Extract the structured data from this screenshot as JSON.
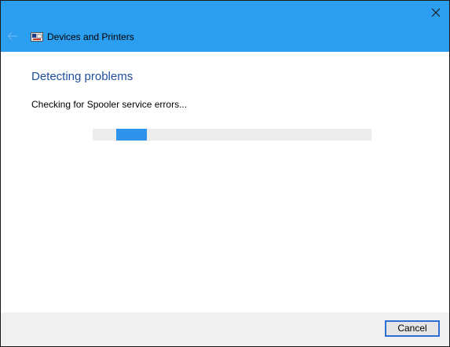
{
  "window": {
    "title": "Devices and Printers",
    "icons": {
      "back": "back-arrow-icon",
      "app": "devices-printers-icon",
      "close": "close-icon"
    },
    "colors": {
      "titlebar": "#2b9ef0",
      "heading": "#1f4e9c",
      "progress_fill": "#2e93ea",
      "progress_track": "#ececec",
      "footer": "#f0f0f0"
    }
  },
  "main": {
    "heading": "Detecting problems",
    "status": "Checking for Spooler service errors...",
    "progress": {
      "mode": "indeterminate",
      "segment_start": 0.085,
      "segment_end": 0.195
    }
  },
  "footer": {
    "cancel_label": "Cancel"
  }
}
